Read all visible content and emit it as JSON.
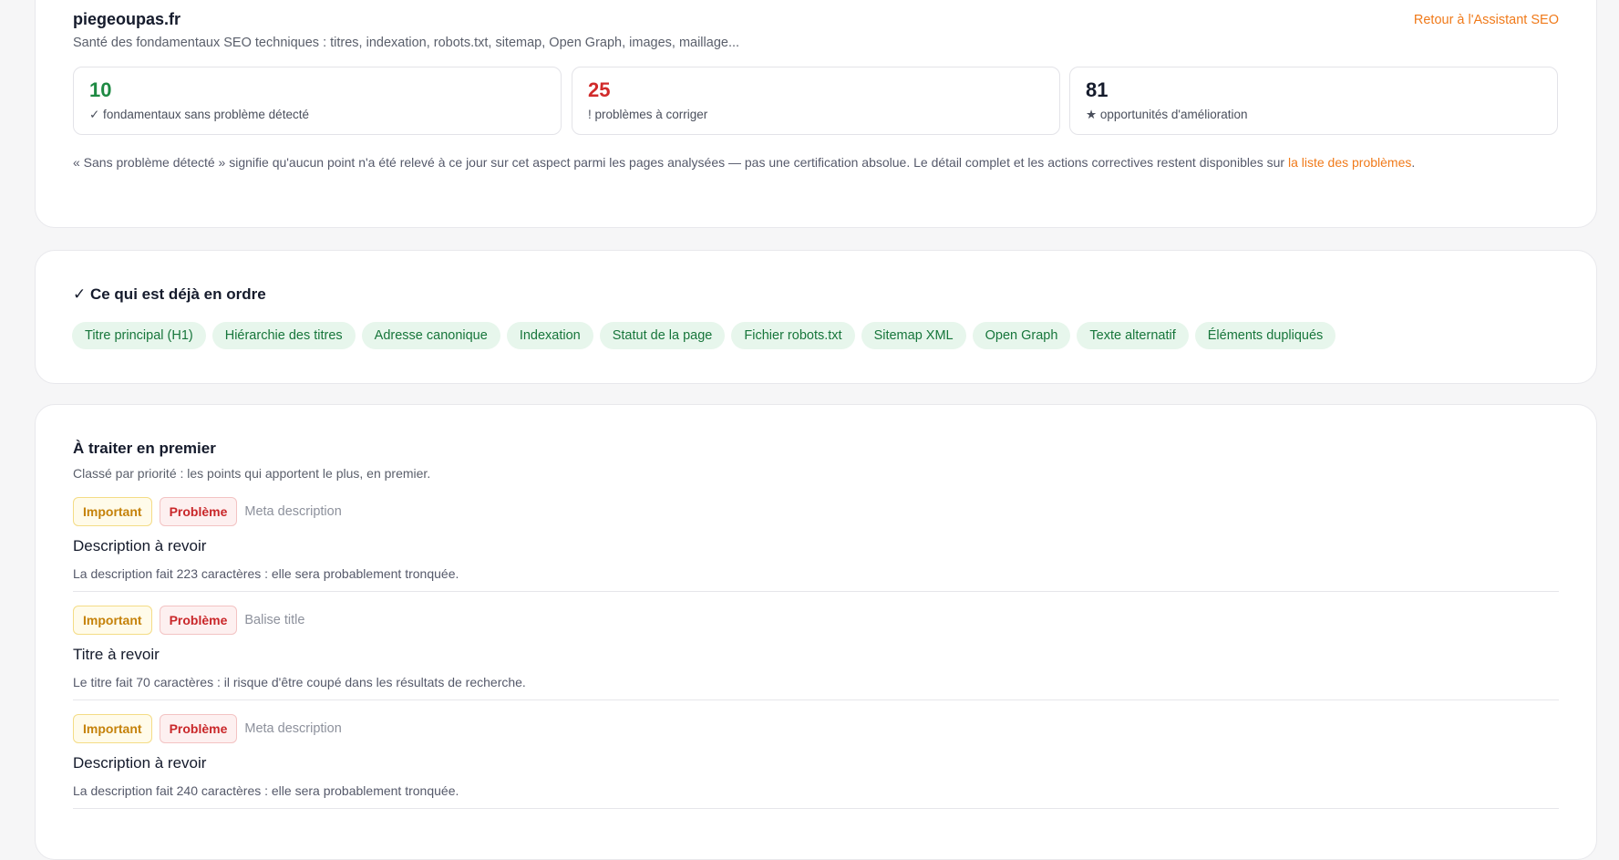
{
  "header": {
    "site": "piegeoupas.fr",
    "subtitle": "Santé des fondamentaux SEO techniques : titres, indexation, robots.txt, sitemap, Open Graph, images, maillage...",
    "back_link": "Retour à l'Assistant SEO"
  },
  "stats": [
    {
      "value": "10",
      "label": "✓ fondamentaux sans problème détecté",
      "color": "#1e8a43"
    },
    {
      "value": "25",
      "label": "! problèmes à corriger",
      "color": "#d12a2a"
    },
    {
      "value": "81",
      "label": "★ opportunités d'amélioration",
      "color": "#151b2c"
    }
  ],
  "note": {
    "text": "« Sans problème détecté » signifie qu'aucun point n'a été relevé à ce jour sur cet aspect parmi les pages analysées — pas une certification absolue. Le détail complet et les actions correctives restent disponibles sur ",
    "link": "la liste des problèmes",
    "end": "."
  },
  "ok_section": {
    "heading": "✓ Ce qui est déjà en ordre",
    "chips": [
      "Titre principal (H1)",
      "Hiérarchie des titres",
      "Adresse canonique",
      "Indexation",
      "Statut de la page",
      "Fichier robots.txt",
      "Sitemap XML",
      "Open Graph",
      "Texte alternatif",
      "Éléments dupliqués"
    ]
  },
  "todo_section": {
    "heading": "À traiter en premier",
    "subtitle": "Classé par priorité : les points qui apportent le plus, en premier.",
    "issues": [
      {
        "priority": "Important",
        "type": "Problème",
        "category": "Meta description",
        "title": "Description à revoir",
        "description": "La description fait 223 caractères : elle sera probablement tronquée."
      },
      {
        "priority": "Important",
        "type": "Problème",
        "category": "Balise title",
        "title": "Titre à revoir",
        "description": "Le titre fait 70 caractères : il risque d'être coupé dans les résultats de recherche."
      },
      {
        "priority": "Important",
        "type": "Problème",
        "category": "Meta description",
        "title": "Description à revoir",
        "description": "La description fait 240 caractères : elle sera probablement tronquée."
      }
    ]
  }
}
